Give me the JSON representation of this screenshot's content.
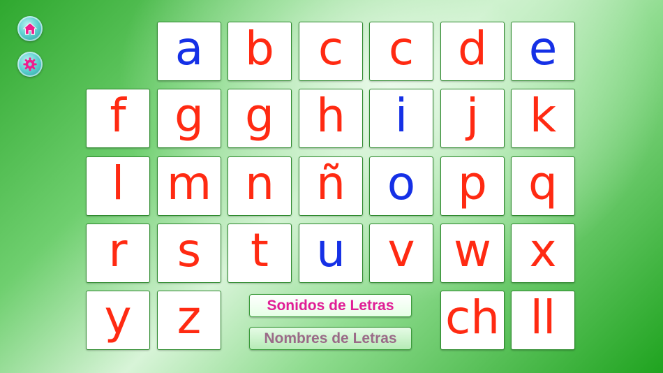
{
  "sidebar": {
    "home_icon": "home-icon",
    "settings_icon": "gear-icon"
  },
  "colors": {
    "consonant": "#ff2a12",
    "vowel": "#1530e6",
    "button_icon": "#ee1d8c",
    "mode_active_text": "#e01e96",
    "mode_inactive_text": "#9a6a88"
  },
  "letters": [
    {
      "id": "a",
      "text": "a",
      "color": "blue"
    },
    {
      "id": "b",
      "text": "b",
      "color": "red"
    },
    {
      "id": "c1",
      "text": "c",
      "color": "red"
    },
    {
      "id": "c2",
      "text": "c",
      "color": "red"
    },
    {
      "id": "d",
      "text": "d",
      "color": "red"
    },
    {
      "id": "e",
      "text": "e",
      "color": "blue"
    },
    {
      "id": "f",
      "text": "f",
      "color": "red"
    },
    {
      "id": "g1",
      "text": "g",
      "color": "red"
    },
    {
      "id": "g2",
      "text": "g",
      "color": "red"
    },
    {
      "id": "h",
      "text": "h",
      "color": "red"
    },
    {
      "id": "i",
      "text": "i",
      "color": "blue"
    },
    {
      "id": "j",
      "text": "j",
      "color": "red"
    },
    {
      "id": "k",
      "text": "k",
      "color": "red"
    },
    {
      "id": "l",
      "text": "l",
      "color": "red"
    },
    {
      "id": "m",
      "text": "m",
      "color": "red"
    },
    {
      "id": "n",
      "text": "n",
      "color": "red"
    },
    {
      "id": "enye",
      "text": "ñ",
      "color": "red"
    },
    {
      "id": "o",
      "text": "o",
      "color": "blue"
    },
    {
      "id": "p",
      "text": "p",
      "color": "red"
    },
    {
      "id": "q",
      "text": "q",
      "color": "red"
    },
    {
      "id": "r",
      "text": "r",
      "color": "red"
    },
    {
      "id": "s",
      "text": "s",
      "color": "red"
    },
    {
      "id": "t",
      "text": "t",
      "color": "red"
    },
    {
      "id": "u",
      "text": "u",
      "color": "blue"
    },
    {
      "id": "v",
      "text": "v",
      "color": "red"
    },
    {
      "id": "w",
      "text": "w",
      "color": "red"
    },
    {
      "id": "x",
      "text": "x",
      "color": "red"
    },
    {
      "id": "y",
      "text": "y",
      "color": "red"
    },
    {
      "id": "z",
      "text": "z",
      "color": "red"
    },
    {
      "id": "ch",
      "text": "ch",
      "color": "red"
    },
    {
      "id": "ll",
      "text": "ll",
      "color": "red"
    }
  ],
  "modes": {
    "sounds_label": "Sonidos de Letras",
    "names_label": "Nombres de Letras"
  }
}
